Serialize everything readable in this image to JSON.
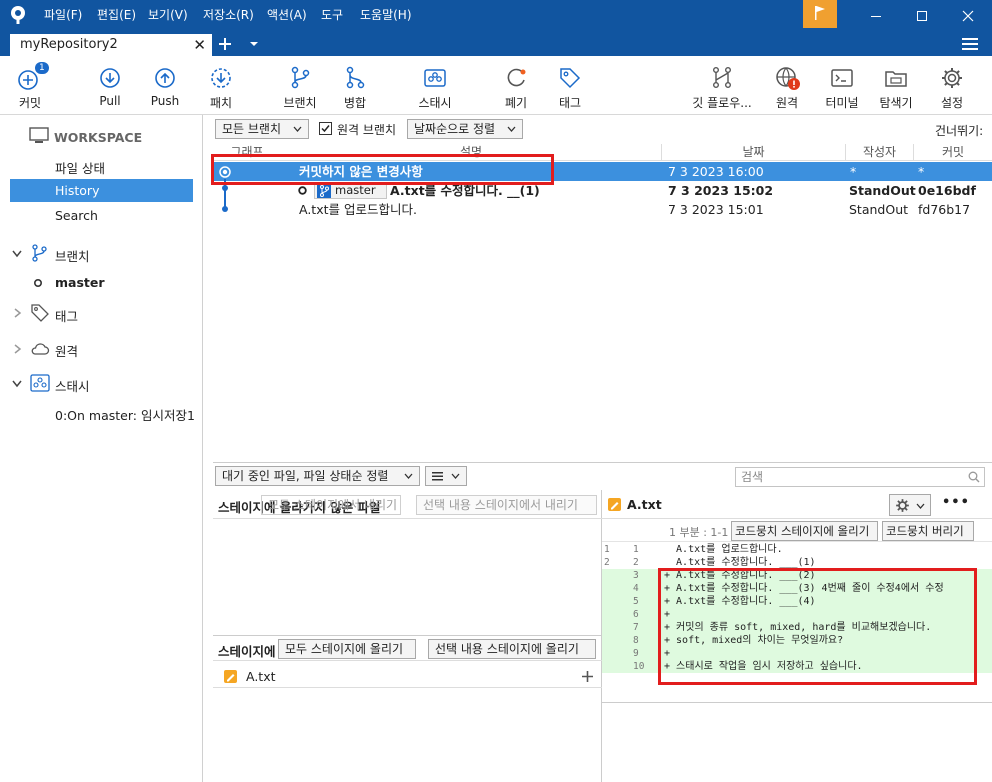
{
  "menu": [
    "파일(F)",
    "편집(E)",
    "보기(V)",
    "저장소(R)",
    "액션(A)",
    "도구",
    "도움말(H)"
  ],
  "tab": {
    "title": "myRepository2"
  },
  "toolbar": {
    "commit": "커밋",
    "commit_badge": "1",
    "pull": "Pull",
    "push": "Push",
    "fetch": "패치",
    "branch": "브랜치",
    "merge": "병합",
    "stash": "스태시",
    "discard": "폐기",
    "tag": "태그",
    "gitflow": "깃 플로우...",
    "remote": "원격",
    "terminal": "터미널",
    "explorer": "탐색기",
    "settings": "설정"
  },
  "sidebar": {
    "workspace": "WORKSPACE",
    "file_status": "파일 상태",
    "history": "History",
    "search": "Search",
    "branches": "브랜치",
    "master": "master",
    "tags": "태그",
    "remotes": "원격",
    "stashes": "스태시",
    "stash_item": "0:On master: 임시저장1"
  },
  "filters": {
    "all_branches": "모든 브랜치",
    "remote_branches": "원격 브랜치",
    "sort": "날짜순으로 정렬",
    "jump": "건너뛰기:"
  },
  "columns": {
    "graph": "그래프",
    "desc": "설명",
    "date": "날짜",
    "author": "작성자",
    "commit": "커밋"
  },
  "commits": [
    {
      "desc": "커밋하지 않은 변경사항",
      "date": "7 3 2023 16:00",
      "author": "*",
      "hash": "*"
    },
    {
      "branch": "master",
      "desc": "A.txt를 수정합니다. __(1)",
      "date": "7 3 2023 15:02",
      "author": "StandOut",
      "hash": "0e16bdf"
    },
    {
      "desc": "A.txt를 업로드합니다.",
      "date": "7 3 2023 15:01",
      "author": "StandOut",
      "hash": "fd76b17"
    }
  ],
  "lower": {
    "pending_sort": "대기 중인 파일, 파일 상태순 정렬",
    "search_placeholder": "검색",
    "unstaged_title": "스테이지에 올라가지 않은 파일",
    "unstage_all": "모두 스테이지에서 내리기",
    "unstage_selected": "선택 내용 스테이지에서 내리기",
    "staged_title": "스테이지에",
    "stage_all": "모두 스테이지에 올리기",
    "stage_selected": "선택 내용 스테이지에 올리기",
    "staged_file": "A.txt",
    "diff_file": "A.txt",
    "hunk_label": "1 부분 : 1-10",
    "stage_hunk": "코드뭉치 스테이지에 올리기",
    "discard_hunk": "코드뭉치 버리기",
    "more": "•••"
  },
  "diff": [
    {
      "old": "1",
      "new": "1",
      "type": "ctx",
      "text": "  A.txt를 업로드합니다."
    },
    {
      "old": "2",
      "new": "2",
      "type": "ctx",
      "text": "  A.txt를 수정합니다. ___(1)"
    },
    {
      "old": "",
      "new": "3",
      "type": "add",
      "text": "+ A.txt를 수정합니다. ___(2)"
    },
    {
      "old": "",
      "new": "4",
      "type": "add",
      "text": "+ A.txt를 수정합니다. ___(3) 4번째 줄이 수정4에서 수정"
    },
    {
      "old": "",
      "new": "5",
      "type": "add",
      "text": "+ A.txt를 수정합니다. ___(4)"
    },
    {
      "old": "",
      "new": "6",
      "type": "add",
      "text": "+"
    },
    {
      "old": "",
      "new": "7",
      "type": "add",
      "text": "+ 커밋의 종류 soft, mixed, hard를 비교해보겠습니다."
    },
    {
      "old": "",
      "new": "8",
      "type": "add",
      "text": "+ soft, mixed의 차이는 무엇일까요?"
    },
    {
      "old": "",
      "new": "9",
      "type": "add",
      "text": "+"
    },
    {
      "old": "",
      "new": "10",
      "type": "add",
      "text": "+ 스태시로 작업을 임시 저장하고 싶습니다."
    }
  ],
  "colors": {
    "accent": "#1155a0",
    "selection": "#3c90de",
    "highlight": "#e21d1d",
    "added": "#dffadf"
  }
}
